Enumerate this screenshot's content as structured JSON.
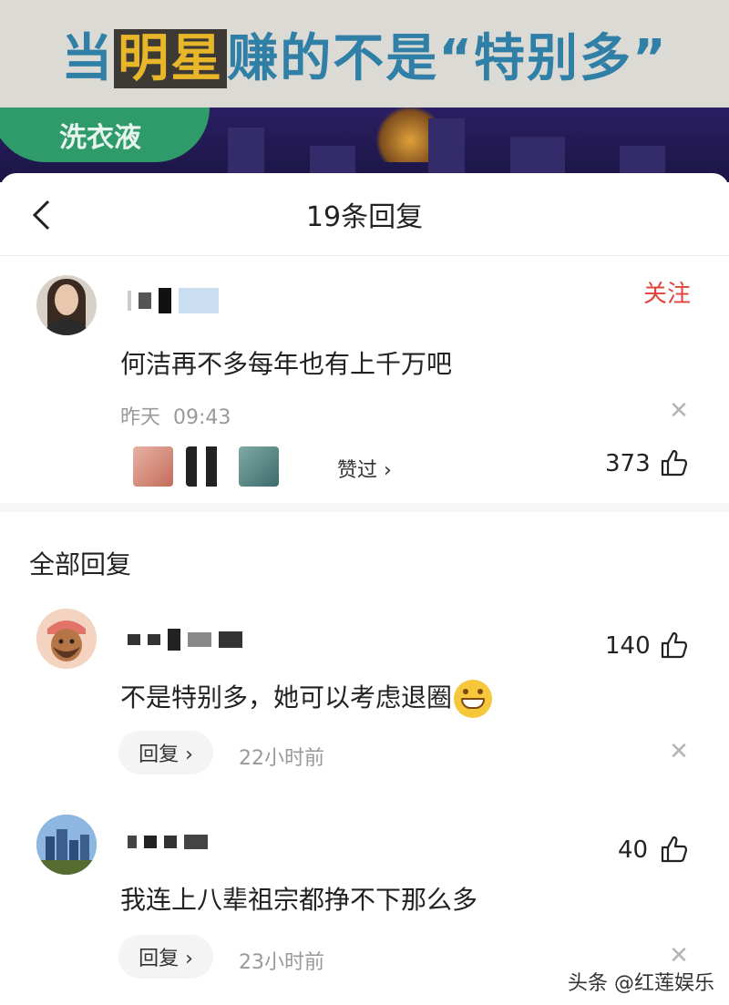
{
  "banner": {
    "title_part1": "当",
    "title_hl": "明星",
    "title_part2": "赚的不是“特别多”",
    "logo_text": "洗衣液"
  },
  "header": {
    "title": "19条回复"
  },
  "main_comment": {
    "follow_label": "关注",
    "text": "何洁再不多每年也有上千万吧",
    "time_prefix": "昨天",
    "time": "09:43",
    "liked_label": "赞过 ›",
    "like_count": "373"
  },
  "section_label": "全部回复",
  "replies": [
    {
      "text": "不是特别多，她可以考虑退圈",
      "like_count": "140",
      "reply_label": "回复 ›",
      "time": "22小时前"
    },
    {
      "text": "我连上八辈祖宗都挣不下那么多",
      "like_count": "40",
      "reply_label": "回复 ›",
      "time": "23小时前"
    }
  ],
  "watermark": "头条 @红莲娱乐",
  "colors": {
    "follow": "#e0433a",
    "muted": "#999999",
    "text": "#222222"
  },
  "icons": {
    "back": "chevron-left-icon",
    "close": "close-icon",
    "like": "thumbs-up-icon"
  }
}
